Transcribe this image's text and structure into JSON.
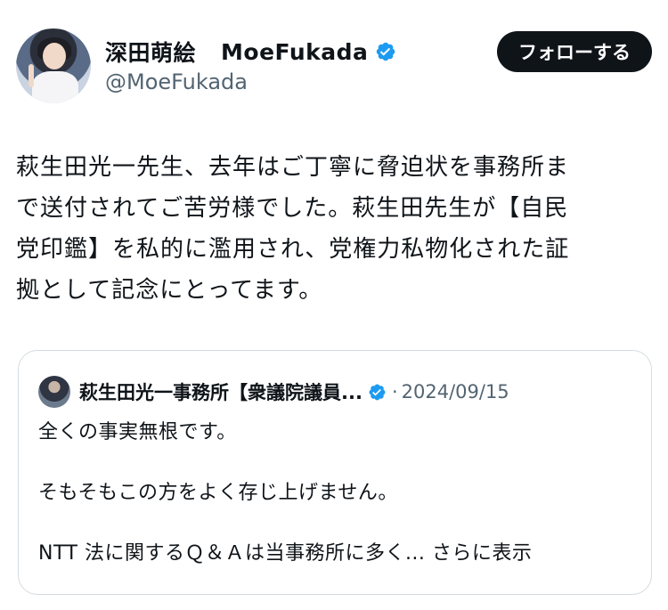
{
  "author": {
    "display_name": "深田萌絵",
    "username_en": "MoeFukada",
    "handle": "@MoeFukada",
    "verified": true
  },
  "follow_button_label": "フォローする",
  "tweet": {
    "lines": [
      "萩生田光一先生、去年はご丁寧に脅迫状を事務所ま",
      "で送付されてご苦労様でした。萩生田先生が【自民",
      "党印鑑】を私的に濫用され、党権力私物化された証",
      "拠として記念にとってます。"
    ]
  },
  "quoted_tweet": {
    "author_name": "萩生田光一事務所【衆議院議員...",
    "verified": true,
    "separator": "·",
    "date": "2024/09/15",
    "lines": [
      "全くの事実無根です。",
      "そもそもこの方をよく存じ上げません。",
      "NTT 法に関するＱ＆Ａは当事務所に多く..."
    ],
    "show_more_label": "さらに表示"
  },
  "colors": {
    "verified_blue": "#1d9bf0",
    "text_primary": "#0f1419",
    "text_secondary": "#536471",
    "border": "#d5dbe0"
  },
  "icons": {
    "verified": "verified-badge-icon"
  }
}
